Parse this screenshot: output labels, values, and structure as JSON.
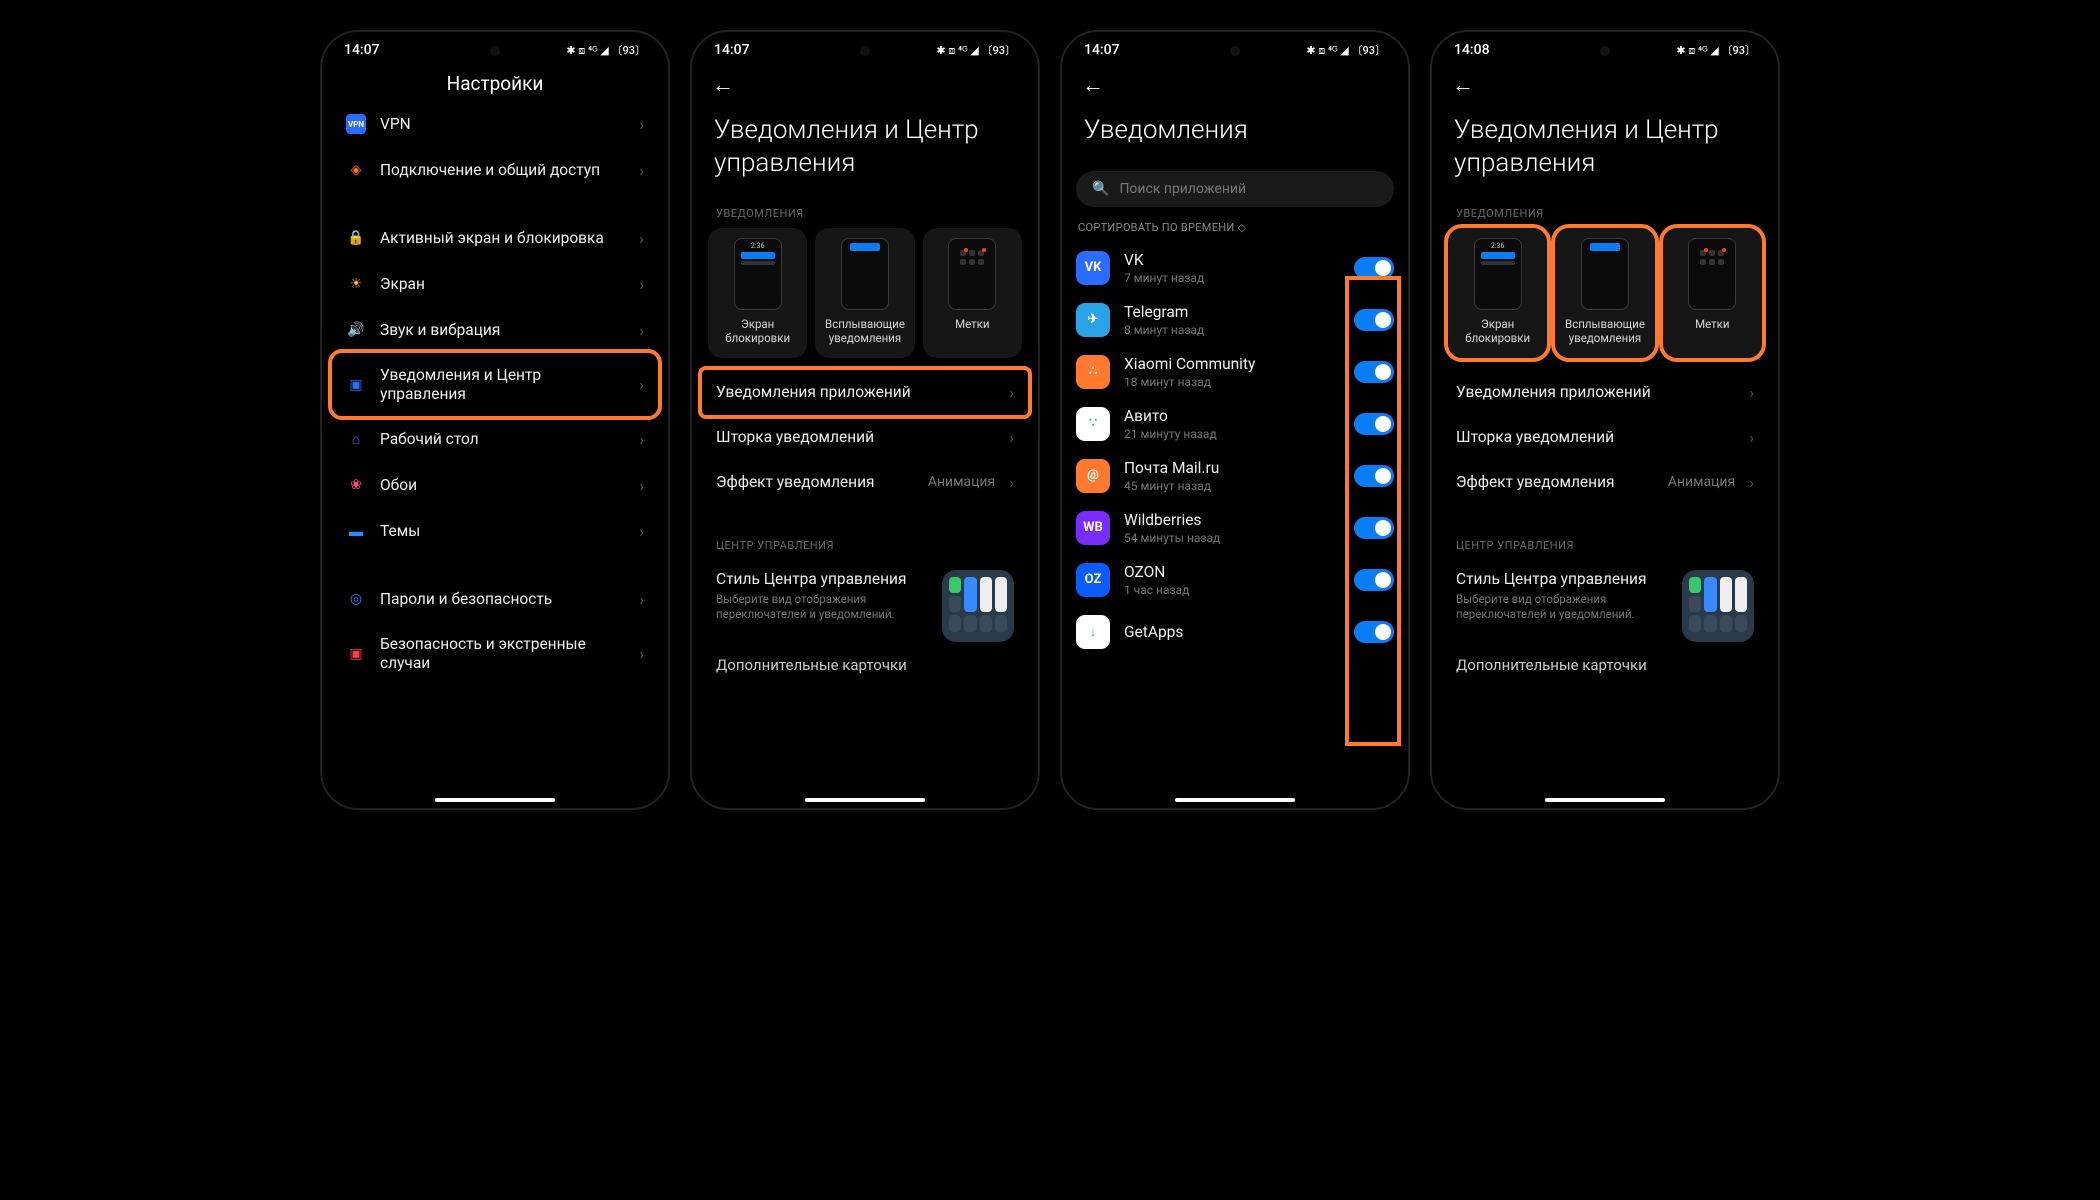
{
  "status": {
    "time1": "14:07",
    "time4": "14:08",
    "icons": "✱ ⧈ ⁴ᴳ ◢ 〔93〕"
  },
  "screen1": {
    "title": "Настройки",
    "items": [
      {
        "icon": "vpn",
        "label": "VPN",
        "color": "#2b6cff",
        "hl": false
      },
      {
        "icon": "share",
        "label": "Подключение и общий доступ",
        "color": "#ff6a2e",
        "hl": false
      },
      {
        "icon": "lock",
        "label": "Активный экран и блокировка",
        "color": "#ff3b47",
        "hl": false
      },
      {
        "icon": "sun",
        "label": "Экран",
        "color": "#ffb02e",
        "hl": false
      },
      {
        "icon": "sound",
        "label": "Звук и вибрация",
        "color": "#3ac96a",
        "hl": false
      },
      {
        "icon": "notif",
        "label": "Уведомления и Центр управления",
        "color": "#2b6cff",
        "hl": true
      },
      {
        "icon": "home",
        "label": "Рабочий стол",
        "color": "#6a5cff",
        "hl": false
      },
      {
        "icon": "wall",
        "label": "Обои",
        "color": "#ff4a7a",
        "hl": false
      },
      {
        "icon": "theme",
        "label": "Темы",
        "color": "#2b8aff",
        "hl": false
      },
      {
        "icon": "sec",
        "label": "Пароли и безопасность",
        "color": "#3a8aff",
        "hl": false
      },
      {
        "icon": "sos",
        "label": "Безопасность и экстренные случаи",
        "color": "#ff3b47",
        "hl": false
      }
    ]
  },
  "screen2": {
    "title": "Уведомления и Центр управления",
    "section1": "УВЕДОМЛЕНИЯ",
    "cards": [
      {
        "label": "Экран блокировки",
        "time": "2:36",
        "hl": false
      },
      {
        "label": "Всплывающие уведомления",
        "hl": false
      },
      {
        "label": "Метки",
        "hl": false
      }
    ],
    "rows": [
      {
        "label": "Уведомления приложений",
        "hl": true
      },
      {
        "label": "Шторка уведомлений",
        "hl": false
      },
      {
        "label": "Эффект уведомления",
        "value": "Анимация",
        "hl": false
      }
    ],
    "section2": "ЦЕНТР УПРАВЛЕНИЯ",
    "cc": {
      "title": "Стиль Центра управления",
      "sub": "Выберите вид отображения переключателей и уведомлений."
    },
    "cut": "Дополнительные карточки"
  },
  "screen3": {
    "title": "Уведомления",
    "search_placeholder": "Поиск приложений",
    "sort": "СОРТИРОВАТЬ ПО ВРЕМЕНИ ◇",
    "apps": [
      {
        "name": "VK",
        "sub": "7 минут назад",
        "bg": "#2b6cff",
        "txt": "VK"
      },
      {
        "name": "Telegram",
        "sub": "8 минут назад",
        "bg": "#2aa4e8",
        "txt": "✈"
      },
      {
        "name": "Xiaomi Community",
        "sub": "18 минут назад",
        "bg": "#ff7a2e",
        "txt": "∴"
      },
      {
        "name": "Авито",
        "sub": "21 минуту назад",
        "bg": "#ffffff",
        "txt": "∵",
        "fg": "#3ac96a"
      },
      {
        "name": "Почта Mail.ru",
        "sub": "45 минут назад",
        "bg": "#ff7a2e",
        "txt": "@"
      },
      {
        "name": "Wildberries",
        "sub": "54 минуты назад",
        "bg": "#7a2bff",
        "txt": "WB"
      },
      {
        "name": "OZON",
        "sub": "1 час назад",
        "bg": "#0a5cff",
        "txt": "OZ"
      },
      {
        "name": "GetApps",
        "sub": "",
        "bg": "#fff",
        "txt": "↓",
        "fg": "#3ac96a"
      }
    ]
  },
  "screen4": {
    "title": "Уведомления и Центр управления",
    "section1": "УВЕДОМЛЕНИЯ",
    "cards": [
      {
        "label": "Экран блокировки",
        "time": "2:36",
        "hl": true
      },
      {
        "label": "Всплывающие уведомления",
        "hl": true
      },
      {
        "label": "Метки",
        "hl": true
      }
    ],
    "rows": [
      {
        "label": "Уведомления приложений",
        "hl": false
      },
      {
        "label": "Шторка уведомлений",
        "hl": false
      },
      {
        "label": "Эффект уведомления",
        "value": "Анимация",
        "hl": false
      }
    ],
    "section2": "ЦЕНТР УПРАВЛЕНИЯ",
    "cc": {
      "title": "Стиль Центра управления",
      "sub": "Выберите вид отображения переключателей и уведомлений."
    },
    "cut": "Дополнительные карточки"
  },
  "glyphs": {
    "vpn": "VPN",
    "share": "◈",
    "lock": "🔒",
    "sun": "☀",
    "sound": "🔊",
    "notif": "▣",
    "home": "⌂",
    "wall": "❀",
    "theme": "▬",
    "sec": "◎",
    "sos": "▣"
  }
}
